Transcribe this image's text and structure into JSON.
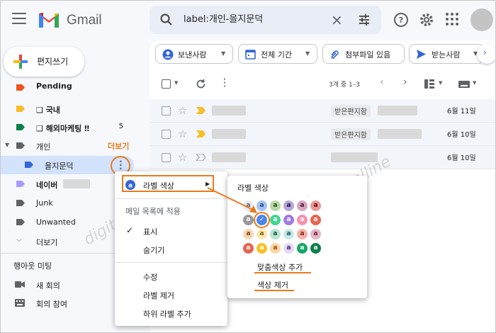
{
  "app": {
    "brand": "Gmail"
  },
  "search": {
    "query": "label:개인-을지문덕"
  },
  "compose": {
    "label": "편지쓰기"
  },
  "nav": {
    "items": [
      {
        "label": "Pending",
        "color": "#f4511e"
      },
      {
        "label": "❑ 국내",
        "color": "#f6bf26"
      },
      {
        "label": "❑ 해외마케팅 ‼",
        "count": "5",
        "color": "#0b8043"
      },
      {
        "label": "개인"
      },
      {
        "label": "을지문덕",
        "color": "#3367d6"
      },
      {
        "label": "네이버",
        "color": "#a79bff"
      },
      {
        "label": "Junk"
      },
      {
        "label": "Unwanted"
      },
      {
        "label": "더보기"
      }
    ],
    "more_label": "더보기",
    "section_meet": "행아웃 미팅",
    "new_meeting": "새 회의",
    "join_meeting": "회의 참여"
  },
  "filters": {
    "from": "보낸사람",
    "time": "전체 기간",
    "attachment": "첨부파일 있음",
    "to": "받는사람"
  },
  "toolbar": {
    "range": "3개 중 1–3"
  },
  "mails": [
    {
      "label": "받은편지함",
      "date": "6월 11일"
    },
    {
      "label": "받은편지함",
      "date": "6월 10일"
    },
    {
      "label": "",
      "date": "6월 10일"
    }
  ],
  "context_menu": {
    "label_color": "라벨 색상",
    "section": "메일 목록에 적용",
    "show": "표시",
    "hide": "숨기기",
    "edit": "수정",
    "remove": "라벨 제거",
    "add_sub": "하위 라벨 추가"
  },
  "palette": {
    "title": "라벨 색상",
    "custom": "맞춤색상 추가",
    "remove": "색상 제거",
    "swatch_glyph": "a"
  },
  "watermark": "digitalline"
}
